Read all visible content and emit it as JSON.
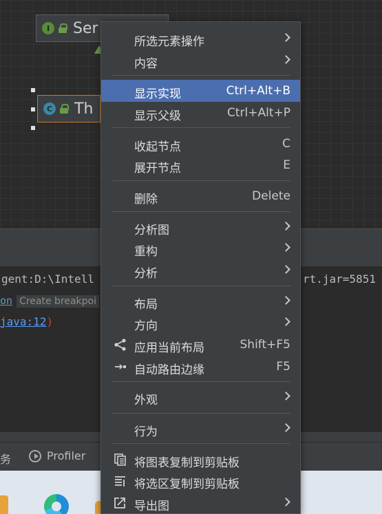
{
  "diagram": {
    "node1": {
      "badge": "I",
      "name": "Ser"
    },
    "node2": {
      "badge": "C",
      "name": "Th"
    }
  },
  "console": {
    "line1_left": "gent:D:\\Intell",
    "line1_right": "rt.jar=5851",
    "line2_prefix": "on",
    "line2_hint": "Create breakpoi",
    "line3_link": "java:12",
    "line3_paren": ")"
  },
  "statusbar": {
    "item1": "务",
    "profiler": "Profiler"
  },
  "menu": {
    "items": [
      {
        "label": "所选元素操作",
        "shortcut": "",
        "submenu": true
      },
      {
        "label": "内容",
        "shortcut": "",
        "submenu": true
      },
      {
        "label": "显示实现",
        "shortcut": "Ctrl+Alt+B",
        "submenu": false,
        "selected": true
      },
      {
        "label": "显示父级",
        "shortcut": "Ctrl+Alt+P",
        "submenu": false
      },
      {
        "label": "收起节点",
        "shortcut": "C",
        "submenu": false
      },
      {
        "label": "展开节点",
        "shortcut": "E",
        "submenu": false
      },
      {
        "label": "删除",
        "shortcut": "Delete",
        "submenu": false
      },
      {
        "label": "分析图",
        "shortcut": "",
        "submenu": true
      },
      {
        "label": "重构",
        "shortcut": "",
        "submenu": true
      },
      {
        "label": "分析",
        "shortcut": "",
        "submenu": true
      },
      {
        "label": "布局",
        "shortcut": "",
        "submenu": true
      },
      {
        "label": "方向",
        "shortcut": "",
        "submenu": true
      },
      {
        "label": "应用当前布局",
        "shortcut": "Shift+F5",
        "submenu": false,
        "icon": "apply-layout-icon"
      },
      {
        "label": "自动路由边缘",
        "shortcut": "F5",
        "submenu": false,
        "icon": "route-edges-icon"
      },
      {
        "label": "外观",
        "shortcut": "",
        "submenu": true
      },
      {
        "label": "行为",
        "shortcut": "",
        "submenu": true
      },
      {
        "label": "将图表复制到剪贴板",
        "shortcut": "",
        "submenu": false,
        "icon": "copy-diagram-icon"
      },
      {
        "label": "将选区复制到剪贴板",
        "shortcut": "",
        "submenu": false,
        "icon": "copy-selection-icon"
      },
      {
        "label": "导出图",
        "shortcut": "",
        "submenu": true,
        "icon": "export-icon"
      }
    ]
  },
  "colors": {
    "menu_bg": "#3c3f41",
    "selection": "#4b6eaf",
    "editor_bg": "#2b2b2b",
    "link": "#589df6"
  }
}
